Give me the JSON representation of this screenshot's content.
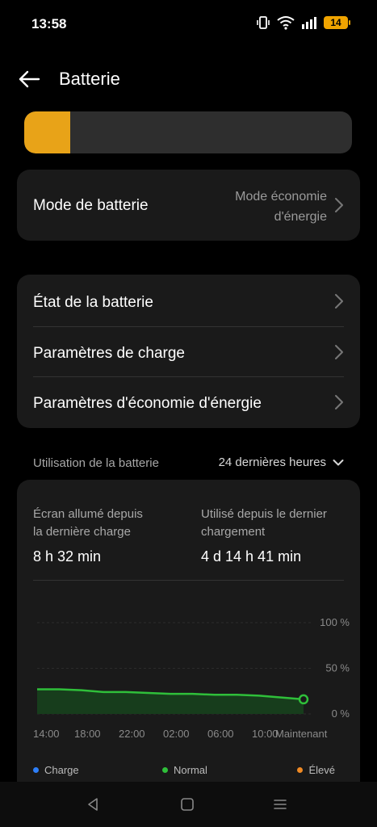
{
  "status_bar": {
    "time": "13:58",
    "battery_level": "14",
    "icons": [
      "vibrate-icon",
      "wifi-icon",
      "signal-icon",
      "battery-icon"
    ]
  },
  "header": {
    "back_icon": "arrow-left-icon",
    "title": "Batterie"
  },
  "battery_bar": {
    "fill_fraction": 0.14,
    "fill_color": "#e8a318"
  },
  "battery_mode": {
    "label": "Mode de batterie",
    "value_line1": "Mode économie",
    "value_line2": "d'énergie"
  },
  "menu": {
    "items": [
      {
        "label": "État de la batterie"
      },
      {
        "label": "Paramètres de charge"
      },
      {
        "label": "Paramètres d'économie d'énergie"
      }
    ]
  },
  "usage": {
    "title": "Utilisation de la batterie",
    "period": "24 dernières heures",
    "screen_on_label_line1": "Écran allumé depuis",
    "screen_on_label_line2": "la dernière charge",
    "screen_on_value": "8 h 32 min",
    "used_label_line1": "Utilisé depuis le dernier",
    "used_label_line2": "chargement",
    "used_value": "4 d 14 h 41 min"
  },
  "chart_data": {
    "type": "area",
    "title": "",
    "xlabel": "",
    "ylabel": "",
    "ylim": [
      0,
      100
    ],
    "y_ticks": [
      "100 %",
      "50 %",
      "0 %"
    ],
    "x_ticks": [
      "14:00",
      "18:00",
      "22:00",
      "02:00",
      "06:00",
      "10:00",
      "Maintenant"
    ],
    "series": [
      {
        "name": "Normal",
        "color": "#2fbf3a",
        "x": [
          "14:00",
          "16:00",
          "18:00",
          "20:00",
          "22:00",
          "00:00",
          "02:00",
          "04:00",
          "06:00",
          "08:00",
          "10:00",
          "12:00",
          "Maintenant"
        ],
        "values": [
          27,
          27,
          26,
          24,
          24,
          23,
          22,
          22,
          21,
          21,
          20,
          18,
          16
        ]
      }
    ],
    "legend": [
      {
        "name": "Charge",
        "color": "#2d7ff9"
      },
      {
        "name": "Normal",
        "color": "#2fbf3a"
      },
      {
        "name": "Élevé",
        "color": "#f08a24"
      }
    ],
    "grid": true,
    "legend_position": "bottom"
  },
  "nav_bar": {
    "icons": [
      "back-triangle-icon",
      "home-square-icon",
      "recents-menu-icon"
    ]
  }
}
